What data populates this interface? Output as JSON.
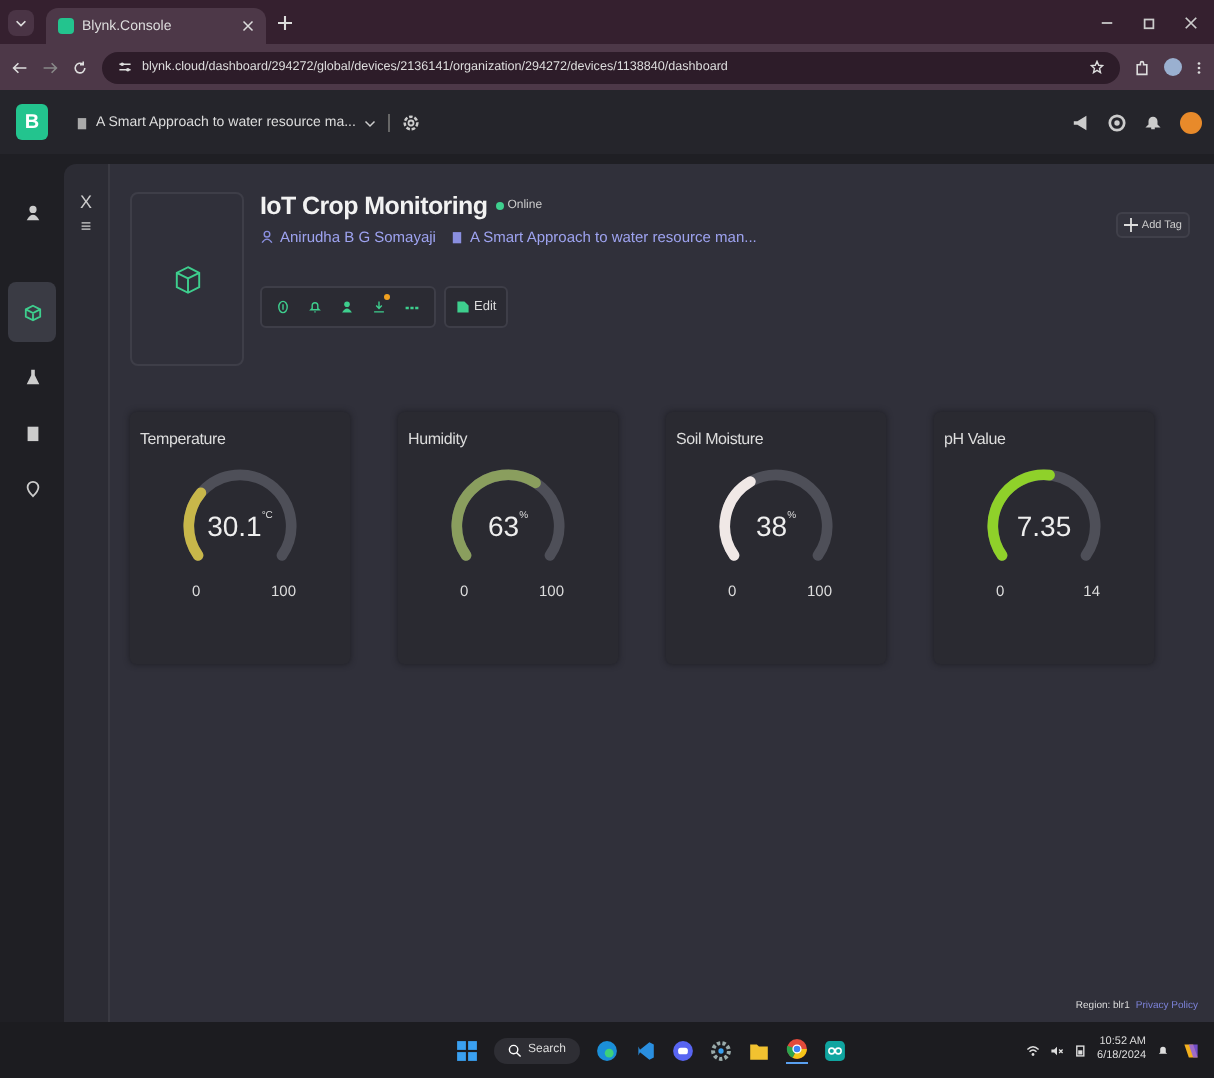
{
  "browser": {
    "tab_title": "Blynk.Console",
    "url": "blynk.cloud/dashboard/294272/global/devices/2136141/organization/294272/devices/1138840/dashboard"
  },
  "app_header": {
    "logo": "B",
    "template": "A Smart Approach to water resource ma..."
  },
  "sidebar": {
    "items": [
      {
        "selected": false
      },
      {
        "selected": true
      },
      {
        "selected": false
      },
      {
        "selected": false
      },
      {
        "selected": false
      }
    ]
  },
  "panel_controls": {
    "close": "X",
    "menu": "≡"
  },
  "device": {
    "name": "IoT Crop Monitoring",
    "status": "Online",
    "online": true,
    "owner": "Anirudha B G Somayaji",
    "template": "A Smart Approach to water resource man...",
    "edit_label": "Edit",
    "add_tag": "Add Tag"
  },
  "gauges": [
    {
      "title": "Temperature",
      "value": "30.1",
      "unit": "°C",
      "min": "0",
      "max": "100",
      "color": "#c8b74a"
    },
    {
      "title": "Humidity",
      "value": "63",
      "unit": "%",
      "min": "0",
      "max": "100",
      "color": "#8a9e5e"
    },
    {
      "title": "Soil Moisture",
      "value": "38",
      "unit": "%",
      "min": "0",
      "max": "100",
      "color": "#f0e8e6"
    },
    {
      "title": "pH Value",
      "value": "7.35",
      "min": "0",
      "max": "14",
      "color": "#8fd12a"
    }
  ],
  "footer": {
    "region": "Region: blr1",
    "privacy": "Privacy Policy"
  },
  "taskbar": {
    "search": "Search",
    "time": "10:52 AM",
    "date": "6/18/2024"
  }
}
